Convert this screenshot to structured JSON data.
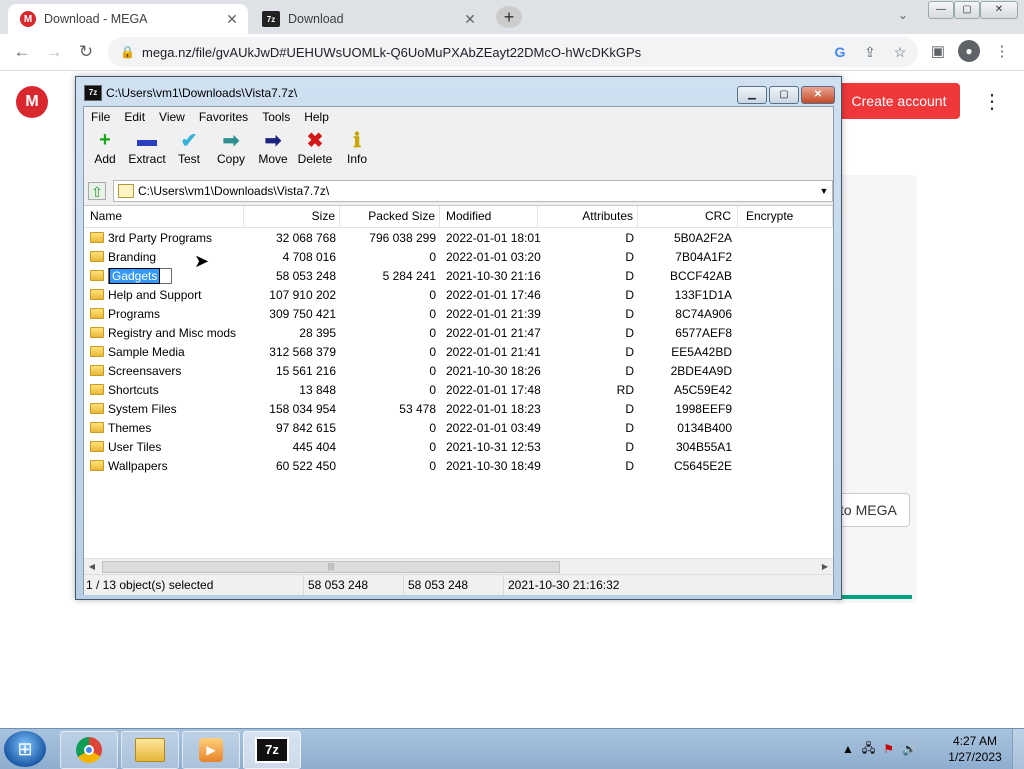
{
  "browser": {
    "tabs": [
      {
        "title": "Download - MEGA",
        "favicon": "M"
      },
      {
        "title": "Download",
        "favicon": "7z"
      }
    ],
    "new_tab": "+",
    "url": "mega.nz/file/gvAUkJwD#UEHUWsUOMLk-Q6UoMuPXAbZEayt22DMcO-hWcDKkGPs",
    "win_controls": [
      "—",
      "▢",
      "✕"
    ]
  },
  "mega": {
    "logo": "M",
    "create_account": "Create account",
    "side_button": "to MEGA",
    "accent": "#f0373a"
  },
  "sevenzip": {
    "title": "C:\\Users\\vm1\\Downloads\\Vista7.7z\\",
    "app_icon": "7z",
    "menu": [
      "File",
      "Edit",
      "View",
      "Favorites",
      "Tools",
      "Help"
    ],
    "tools": [
      {
        "label": "Add",
        "icon": "+",
        "color": "#19a519"
      },
      {
        "label": "Extract",
        "icon": "▬",
        "color": "#2a3fbf"
      },
      {
        "label": "Test",
        "icon": "✔",
        "color": "#33b4d8"
      },
      {
        "label": "Copy",
        "icon": "➡",
        "color": "#2e8f8f"
      },
      {
        "label": "Move",
        "icon": "➡",
        "color": "#1a237e"
      },
      {
        "label": "Delete",
        "icon": "✖",
        "color": "#d01818"
      },
      {
        "label": "Info",
        "icon": "ℹ",
        "color": "#c7a600"
      }
    ],
    "address": "C:\\Users\\vm1\\Downloads\\Vista7.7z\\",
    "columns": [
      "Name",
      "Size",
      "Packed Size",
      "Modified",
      "Attributes",
      "CRC",
      "Encrypte"
    ],
    "rows": [
      {
        "name": "3rd Party Programs",
        "size": "32 068 768",
        "packed": "796 038 299",
        "modified": "2022-01-01 18:01",
        "attr": "D",
        "crc": "5B0A2F2A"
      },
      {
        "name": "Branding",
        "size": "4 708 016",
        "packed": "0",
        "modified": "2022-01-01 03:20",
        "attr": "D",
        "crc": "7B04A1F2"
      },
      {
        "name": "Gadgets",
        "size": "58 053 248",
        "packed": "5 284 241",
        "modified": "2021-10-30 21:16",
        "attr": "D",
        "crc": "BCCF42AB"
      },
      {
        "name": "Help and Support",
        "size": "107 910 202",
        "packed": "0",
        "modified": "2022-01-01 17:46",
        "attr": "D",
        "crc": "133F1D1A"
      },
      {
        "name": "Programs",
        "size": "309 750 421",
        "packed": "0",
        "modified": "2022-01-01 21:39",
        "attr": "D",
        "crc": "8C74A906"
      },
      {
        "name": "Registry and Misc mods",
        "size": "28 395",
        "packed": "0",
        "modified": "2022-01-01 21:47",
        "attr": "D",
        "crc": "6577AEF8"
      },
      {
        "name": "Sample Media",
        "size": "312 568 379",
        "packed": "0",
        "modified": "2022-01-01 21:41",
        "attr": "D",
        "crc": "EE5A42BD"
      },
      {
        "name": "Screensavers",
        "size": "15 561 216",
        "packed": "0",
        "modified": "2021-10-30 18:26",
        "attr": "D",
        "crc": "2BDE4A9D"
      },
      {
        "name": "Shortcuts",
        "size": "13 848",
        "packed": "0",
        "modified": "2022-01-01 17:48",
        "attr": "RD",
        "crc": "A5C59E42"
      },
      {
        "name": "System Files",
        "size": "158 034 954",
        "packed": "53 478",
        "modified": "2022-01-01 18:23",
        "attr": "D",
        "crc": "1998EEF9"
      },
      {
        "name": "Themes",
        "size": "97 842 615",
        "packed": "0",
        "modified": "2022-01-01 03:49",
        "attr": "D",
        "crc": "0134B400"
      },
      {
        "name": "User Tiles",
        "size": "445 404",
        "packed": "0",
        "modified": "2021-10-31 12:53",
        "attr": "D",
        "crc": "304B55A1"
      },
      {
        "name": "Wallpapers",
        "size": "60 522 450",
        "packed": "0",
        "modified": "2021-10-30 18:49",
        "attr": "D",
        "crc": "C5645E2E"
      }
    ],
    "renaming_row": 2,
    "status": [
      "1 / 13 object(s) selected",
      "58 053 248",
      "58 053 248",
      "2021-10-30 21:16:32"
    ]
  },
  "taskbar": {
    "start": "⊞",
    "apps": [
      "chrome",
      "explorer",
      "media-player",
      "7-zip"
    ],
    "time": "4:27 AM",
    "date": "1/27/2023"
  }
}
